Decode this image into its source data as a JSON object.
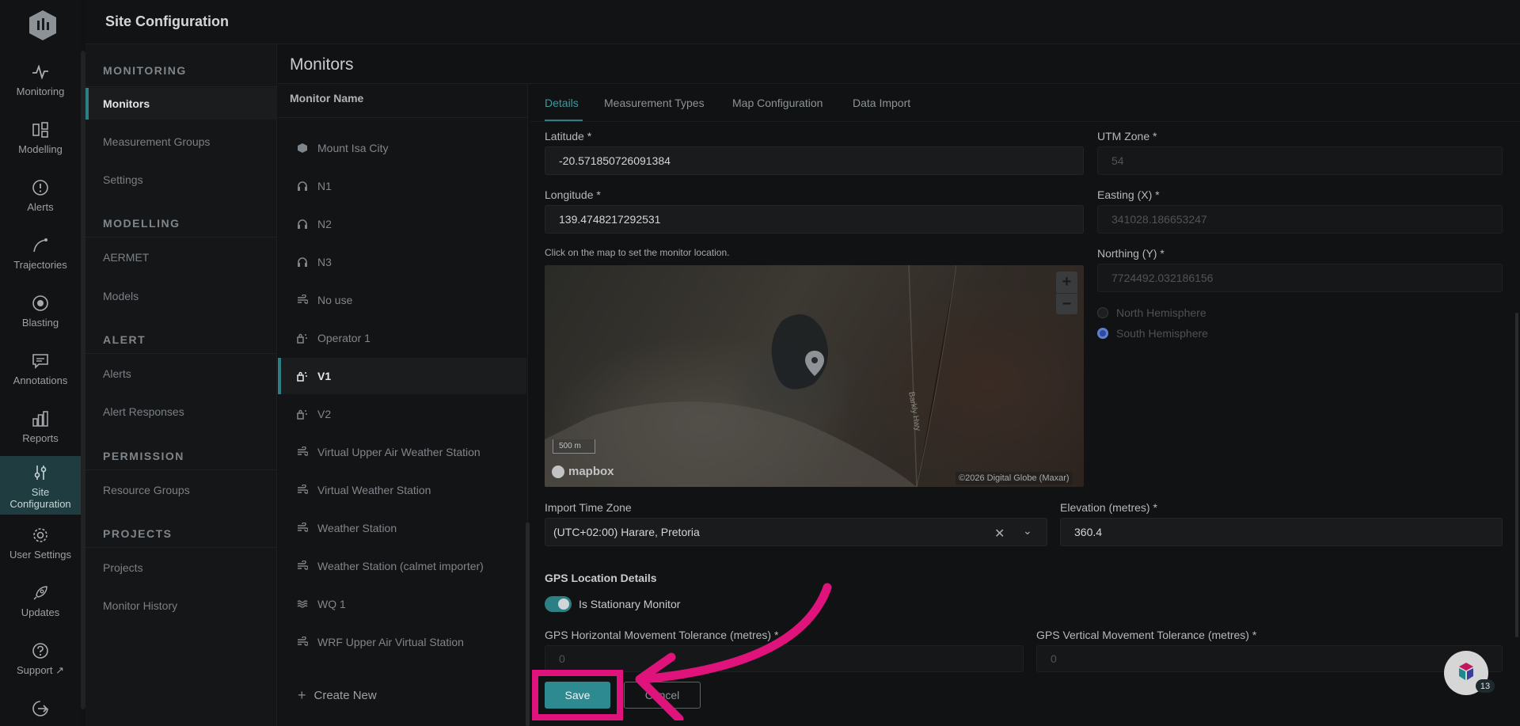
{
  "app": {
    "title": "Site Configuration"
  },
  "rail": {
    "items": [
      {
        "label": "Monitoring",
        "icon": "pulse-icon"
      },
      {
        "label": "Modelling",
        "icon": "modelling-icon"
      },
      {
        "label": "Alerts",
        "icon": "alert-circle-icon"
      },
      {
        "label": "Trajectories",
        "icon": "trajectory-icon"
      },
      {
        "label": "Blasting",
        "icon": "target-icon"
      },
      {
        "label": "Annotations",
        "icon": "comment-icon"
      },
      {
        "label": "Reports",
        "icon": "bar-chart-icon"
      },
      {
        "label": "Site Configuration",
        "icon": "sliders-icon"
      },
      {
        "label": "User Settings",
        "icon": "gear-icon"
      },
      {
        "label": "Updates",
        "icon": "rocket-icon"
      },
      {
        "label": "Support",
        "icon": "help-circle-icon"
      },
      {
        "label": "",
        "icon": "logout-icon"
      }
    ]
  },
  "sidebar": {
    "sections": [
      {
        "title": "MONITORING",
        "items": [
          "Monitors",
          "Measurement Groups",
          "Settings"
        ]
      },
      {
        "title": "MODELLING",
        "items": [
          "AERMET",
          "Models"
        ]
      },
      {
        "title": "ALERT",
        "items": [
          "Alerts",
          "Alert Responses"
        ]
      },
      {
        "title": "PERMISSION",
        "items": [
          "Resource Groups"
        ]
      },
      {
        "title": "PROJECTS",
        "items": [
          "Projects",
          "Monitor History"
        ]
      }
    ]
  },
  "monitors": {
    "title": "Monitors",
    "column_header": "Monitor Name",
    "items": [
      {
        "name": "Mount Isa City",
        "icon": "cube-icon"
      },
      {
        "name": "N1",
        "icon": "headphones-icon"
      },
      {
        "name": "N2",
        "icon": "headphones-icon"
      },
      {
        "name": "N3",
        "icon": "headphones-icon"
      },
      {
        "name": "No use",
        "icon": "weather-icon"
      },
      {
        "name": "Operator 1",
        "icon": "vibration-icon"
      },
      {
        "name": "V1",
        "icon": "vibration-icon"
      },
      {
        "name": "V2",
        "icon": "vibration-icon"
      },
      {
        "name": "Virtual Upper Air Weather Station",
        "icon": "weather-icon"
      },
      {
        "name": "Virtual Weather Station",
        "icon": "weather-icon"
      },
      {
        "name": "Weather Station",
        "icon": "weather-icon"
      },
      {
        "name": "Weather Station (calmet importer)",
        "icon": "weather-icon"
      },
      {
        "name": "WQ 1",
        "icon": "water-icon"
      },
      {
        "name": "WRF Upper Air Virtual Station",
        "icon": "weather-icon"
      }
    ],
    "create_new": "Create New"
  },
  "tabs": [
    "Details",
    "Measurement Types",
    "Map Configuration",
    "Data Import"
  ],
  "form": {
    "latitude_label": "Latitude *",
    "latitude_value": "-20.571850726091384",
    "longitude_label": "Longitude *",
    "longitude_value": "139.4748217292531",
    "map_hint": "Click on the map to set the monitor location.",
    "utm_zone_label": "UTM Zone *",
    "utm_zone_value": "54",
    "easting_label": "Easting (X) *",
    "easting_value": "341028.186653247",
    "northing_label": "Northing (Y) *",
    "northing_value": "7724492.032186156",
    "hemisphere_north": "North Hemisphere",
    "hemisphere_south": "South Hemisphere",
    "timezone_label": "Import Time Zone",
    "timezone_value": "(UTC+02:00) Harare, Pretoria",
    "elevation_label": "Elevation (metres) *",
    "elevation_value": "360.4",
    "gps_section": "GPS Location Details",
    "stationary_label": "Is Stationary Monitor",
    "gps_h_label": "GPS Horizontal Movement Tolerance (metres) *",
    "gps_h_value": "0",
    "gps_v_label": "GPS Vertical Movement Tolerance (metres) *",
    "gps_v_value": "0",
    "save": "Save",
    "cancel": "Cancel"
  },
  "map": {
    "scale": "500 m",
    "brand": "mapbox",
    "attribution": "©2026 Digital Globe (Maxar)",
    "road": "Barkly Hwy",
    "zoom_in": "+",
    "zoom_out": "−"
  },
  "chat": {
    "badge": "13"
  },
  "colors": {
    "accent": "#2d7f86",
    "highlight": "#e0127c",
    "background": "#111213"
  }
}
